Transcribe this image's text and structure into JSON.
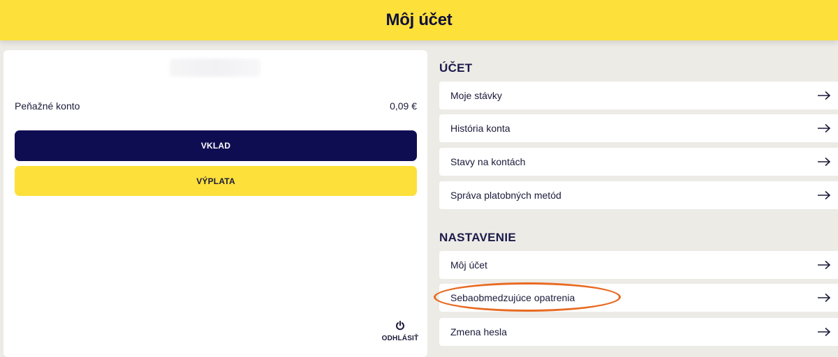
{
  "header": {
    "title": "Môj účet"
  },
  "wallet": {
    "balance_label": "Peňažné konto",
    "balance_value": "0,09 €",
    "deposit_label": "VKLAD",
    "withdraw_label": "VÝPLATA",
    "logout_label": "ODHLÁSIŤ",
    "logout_icon": "power-icon"
  },
  "sections": {
    "account": {
      "title": "ÚČET",
      "items": [
        {
          "label": "Moje stávky"
        },
        {
          "label": "História konta"
        },
        {
          "label": "Stavy na kontách"
        },
        {
          "label": "Správa platobných metód"
        }
      ]
    },
    "settings": {
      "title": "NASTAVENIE",
      "items": [
        {
          "label": "Môj účet"
        },
        {
          "label": "Sebaobmedzujúce opatrenia"
        },
        {
          "label": "Zmena hesla"
        }
      ]
    }
  },
  "colors": {
    "header_bg": "#fde03a",
    "deposit_bg": "#0f0d52",
    "withdraw_bg": "#fde03a",
    "page_bg": "#ecebe6",
    "highlight": "#e86a21"
  },
  "icons": {
    "menu_arrow": "arrow-right-icon"
  }
}
